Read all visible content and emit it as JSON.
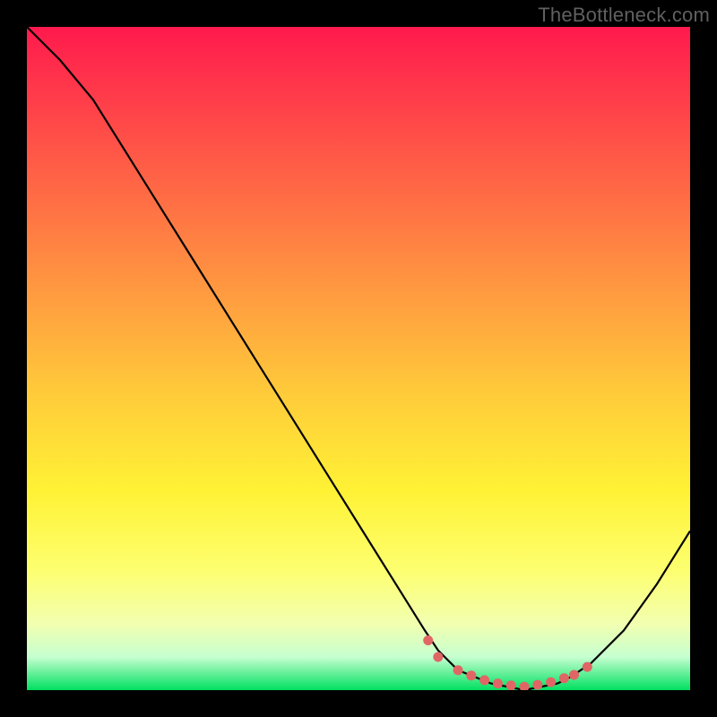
{
  "watermark": "TheBottleneck.com",
  "chart_data": {
    "type": "line",
    "title": "",
    "xlabel": "",
    "ylabel": "",
    "xlim": [
      0,
      100
    ],
    "ylim": [
      0,
      100
    ],
    "grid": false,
    "legend": false,
    "series": [
      {
        "name": "bottleneck-curve",
        "x": [
          0,
          5,
          10,
          15,
          20,
          25,
          30,
          35,
          40,
          45,
          50,
          55,
          60,
          62,
          65,
          70,
          75,
          80,
          82,
          85,
          90,
          95,
          100
        ],
        "y": [
          100,
          95,
          89,
          81,
          73,
          65,
          57,
          49,
          41,
          33,
          25,
          17,
          9,
          6,
          3,
          1,
          0,
          1,
          2,
          4,
          9,
          16,
          24
        ]
      }
    ],
    "markers": {
      "name": "highlight-dots",
      "color": "#e06666",
      "x": [
        60.5,
        62,
        65,
        67,
        69,
        71,
        73,
        75,
        77,
        79,
        81,
        82.5,
        84.5
      ],
      "y": [
        7.5,
        5,
        3,
        2.2,
        1.5,
        1,
        0.7,
        0.5,
        0.8,
        1.2,
        1.8,
        2.3,
        3.5
      ]
    }
  },
  "colors": {
    "curve": "#000000",
    "dots": "#e06666",
    "frame": "#000000"
  }
}
